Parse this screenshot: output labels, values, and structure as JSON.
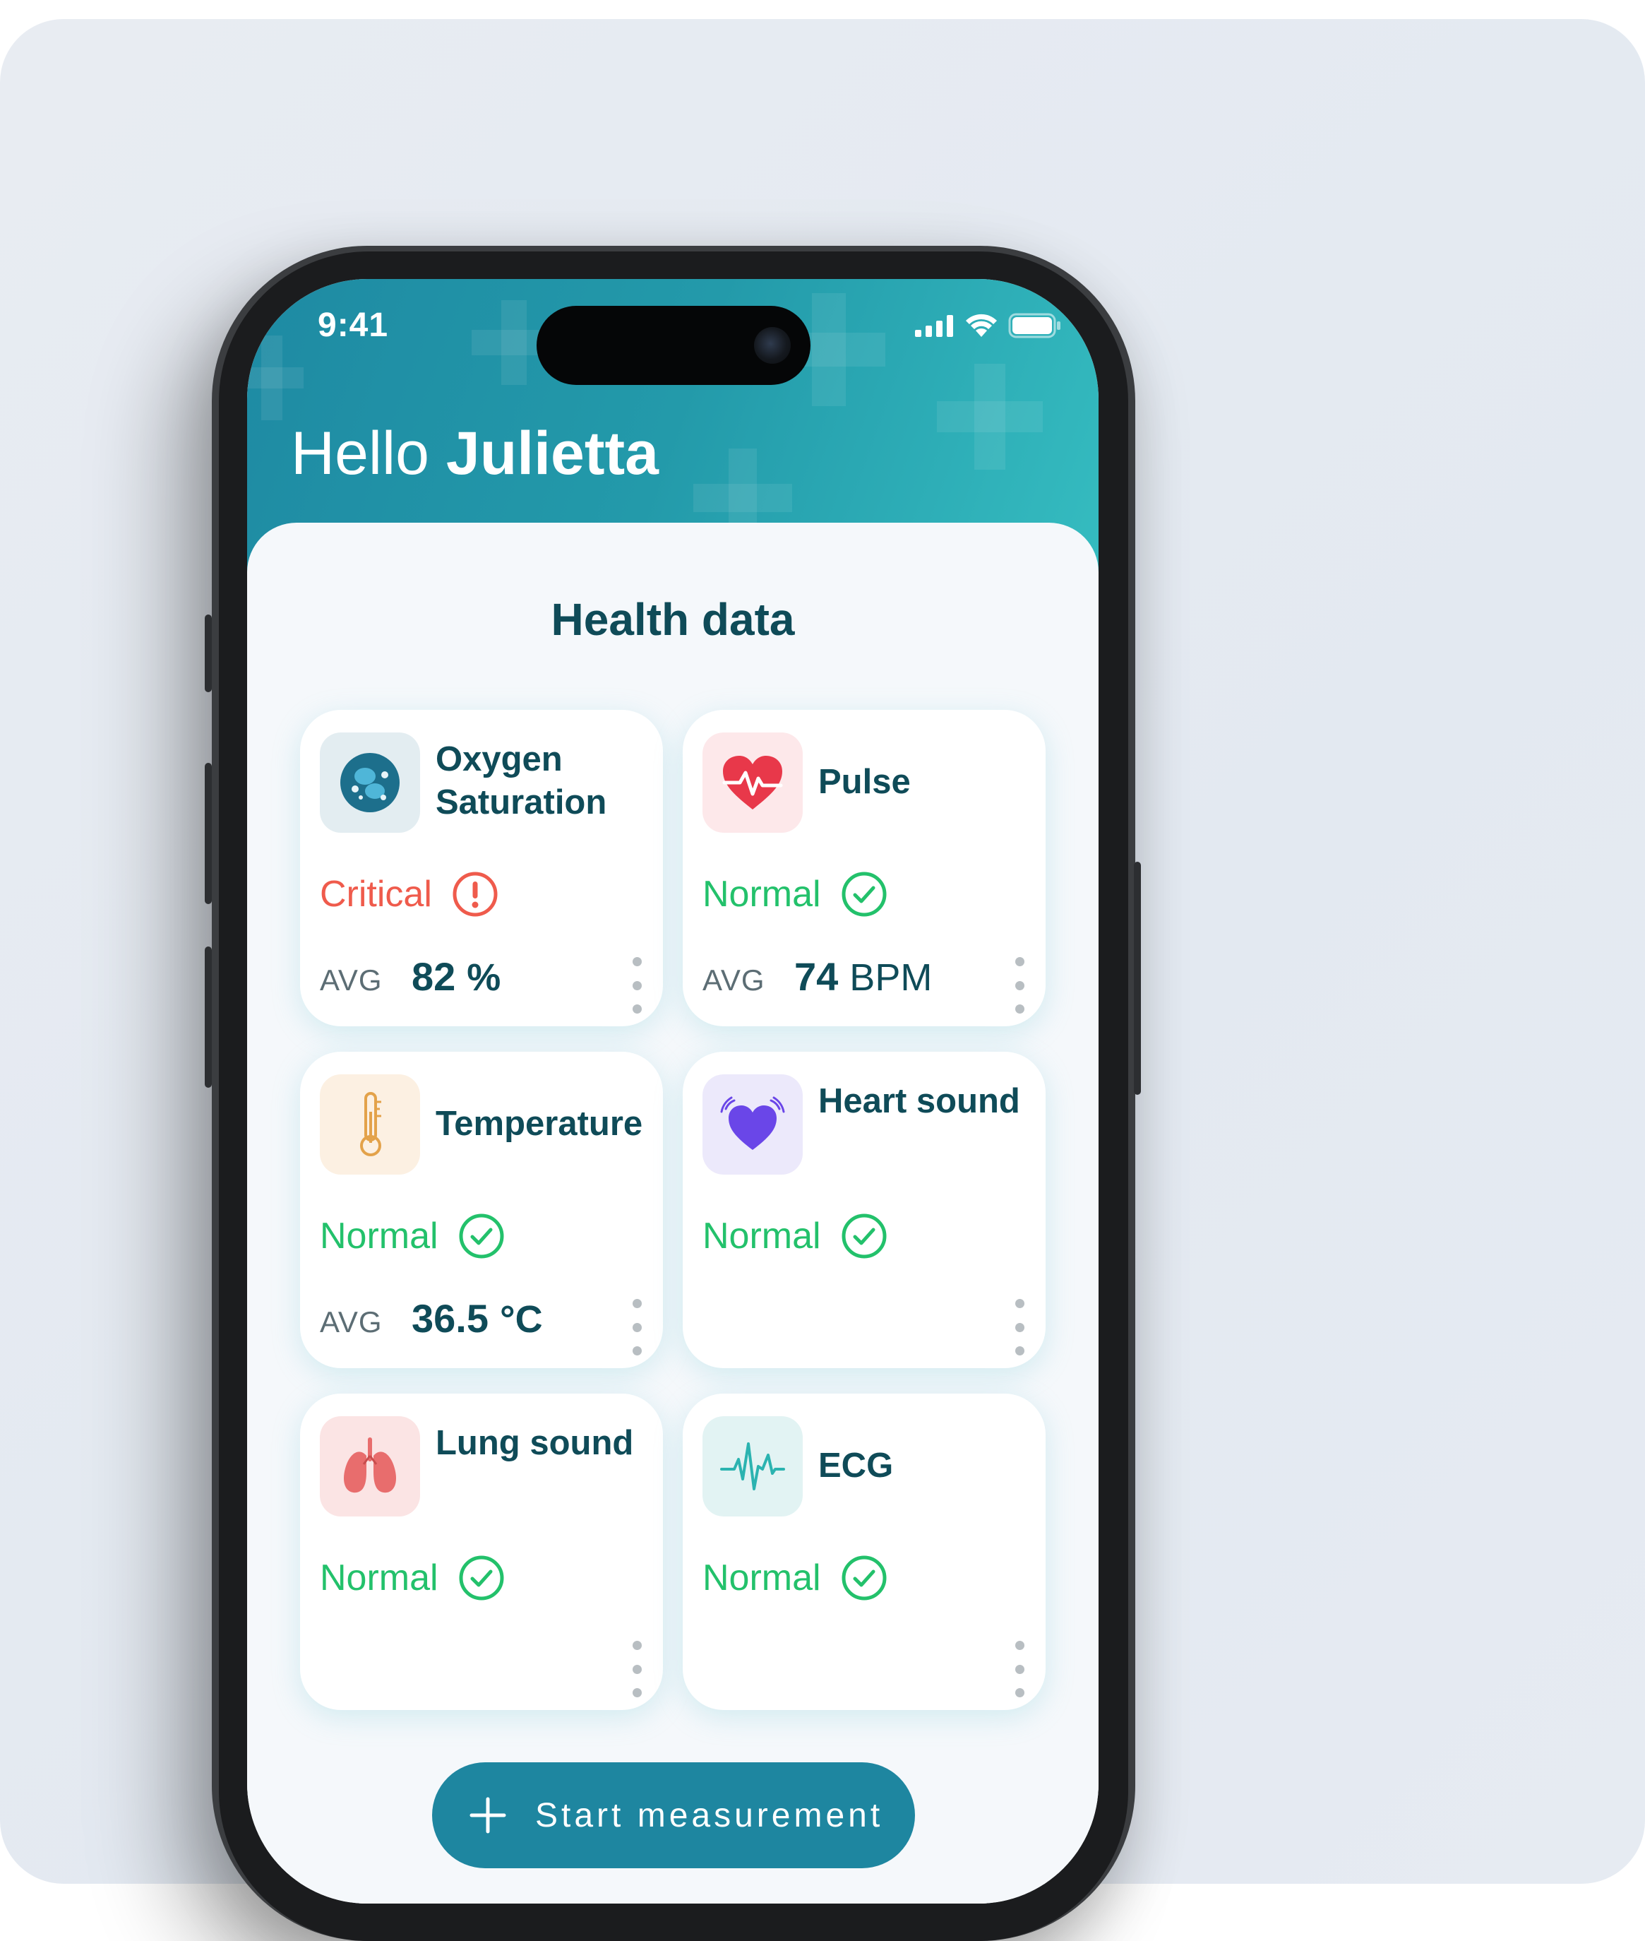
{
  "status_bar": {
    "time": "9:41"
  },
  "greeting": {
    "prefix": "Hello",
    "name": "Julietta"
  },
  "section_title": "Health data",
  "cards": [
    {
      "name": "Oxygen Saturation",
      "icon": "oxygen-molecule-icon",
      "status": "Critical",
      "status_icon": "alert-circle-icon",
      "avg_label": "AVG",
      "avg_value": "82",
      "avg_unit": "%"
    },
    {
      "name": "Pulse",
      "icon": "heart-pulse-icon",
      "status": "Normal",
      "status_icon": "check-circle-icon",
      "avg_label": "AVG",
      "avg_value": "74",
      "avg_unit": "BPM"
    },
    {
      "name": "Temperature",
      "icon": "thermometer-icon",
      "status": "Normal",
      "status_icon": "check-circle-icon",
      "avg_label": "AVG",
      "avg_value": "36.5",
      "avg_unit": "°C"
    },
    {
      "name": "Heart sound",
      "icon": "heart-sound-icon",
      "status": "Normal",
      "status_icon": "check-circle-icon"
    },
    {
      "name": "Lung sound",
      "icon": "lungs-icon",
      "status": "Normal",
      "status_icon": "check-circle-icon"
    },
    {
      "name": "ECG",
      "icon": "ecg-icon",
      "status": "Normal",
      "status_icon": "check-circle-icon"
    }
  ],
  "cta": {
    "label": "Start measurement",
    "icon": "plus-icon"
  },
  "colors": {
    "header_start": "#1e8aa3",
    "header_end": "#35bcc0",
    "title": "#0f4b58",
    "normal": "#23c16b",
    "critical": "#ef5b4c",
    "cta": "#1e86a0"
  }
}
